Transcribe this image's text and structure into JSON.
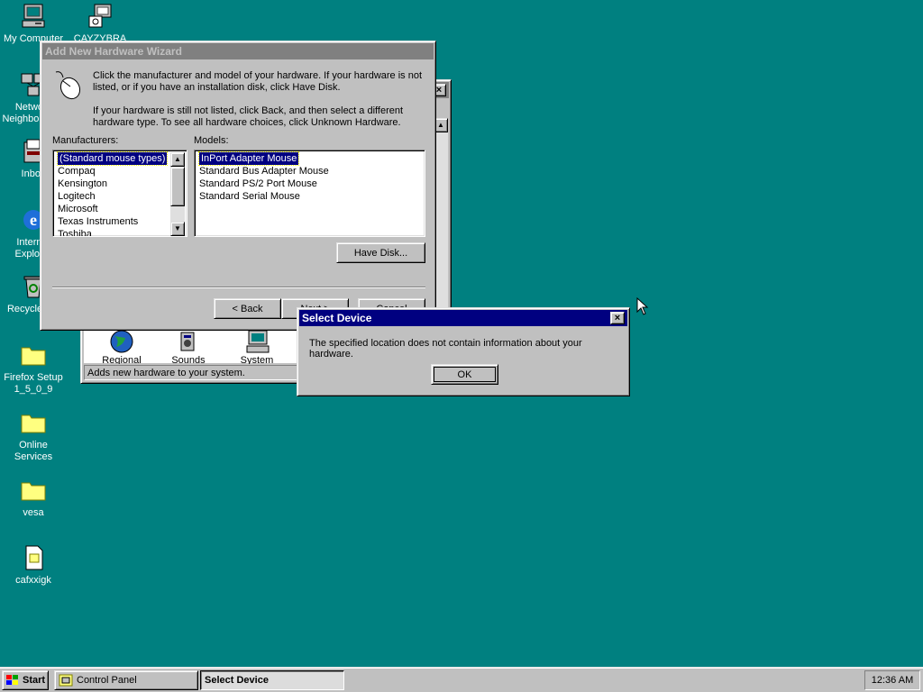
{
  "desktop": {
    "icons": [
      {
        "label": "My Computer",
        "icon": "my-computer-icon"
      },
      {
        "label": "CAYZYBRA",
        "icon": "network-computer-icon"
      },
      {
        "label": "Network Neighborhood",
        "icon": "network-neighborhood-icon"
      },
      {
        "label": "Inbox",
        "icon": "inbox-icon"
      },
      {
        "label": "Internet Explorer",
        "icon": "internet-explorer-icon"
      },
      {
        "label": "Recycle Bin",
        "icon": "recycle-bin-icon"
      },
      {
        "label": "Firefox Setup 1_5_0_9",
        "icon": "folder-icon"
      },
      {
        "label": "Online Services",
        "icon": "folder-icon"
      },
      {
        "label": "vesa",
        "icon": "folder-icon"
      },
      {
        "label": "cafxxigk",
        "icon": "file-icon"
      }
    ]
  },
  "control_panel": {
    "icons": [
      {
        "label": "Regional",
        "icon": "globe-icon"
      },
      {
        "label": "Sounds",
        "icon": "speaker-icon"
      },
      {
        "label": "System",
        "icon": "system-icon"
      }
    ],
    "status": "Adds new hardware to your system."
  },
  "wizard": {
    "title": "Add New Hardware Wizard",
    "instructions_1": "Click the manufacturer and model of your hardware. If your hardware is not listed, or if you have an installation disk, click Have Disk.",
    "instructions_2": "If your hardware is still not listed, click Back, and then select a different hardware type. To see all hardware choices, click Unknown Hardware.",
    "manufacturers_label": "Manufacturers:",
    "manufacturers": [
      "(Standard mouse types)",
      "Compaq",
      "Kensington",
      "Logitech",
      "Microsoft",
      "Texas Instruments",
      "Toshiba"
    ],
    "models_label": "Models:",
    "models": [
      "InPort Adapter Mouse",
      "Standard Bus Adapter Mouse",
      "Standard PS/2 Port Mouse",
      "Standard Serial Mouse"
    ],
    "have_disk": "Have Disk...",
    "back": "< Back",
    "next": "Next >",
    "cancel": "Cancel"
  },
  "dialog": {
    "title": "Select Device",
    "message": "The specified location does not contain information about your hardware.",
    "ok": "OK"
  },
  "taskbar": {
    "start": "Start",
    "tasks": [
      "Control Panel",
      "Select Device"
    ],
    "clock": "12:36 AM"
  },
  "colors": {
    "desktop": "#008080",
    "title_active": "#000080",
    "title_inactive": "#808080",
    "face": "#c0c0c0"
  }
}
